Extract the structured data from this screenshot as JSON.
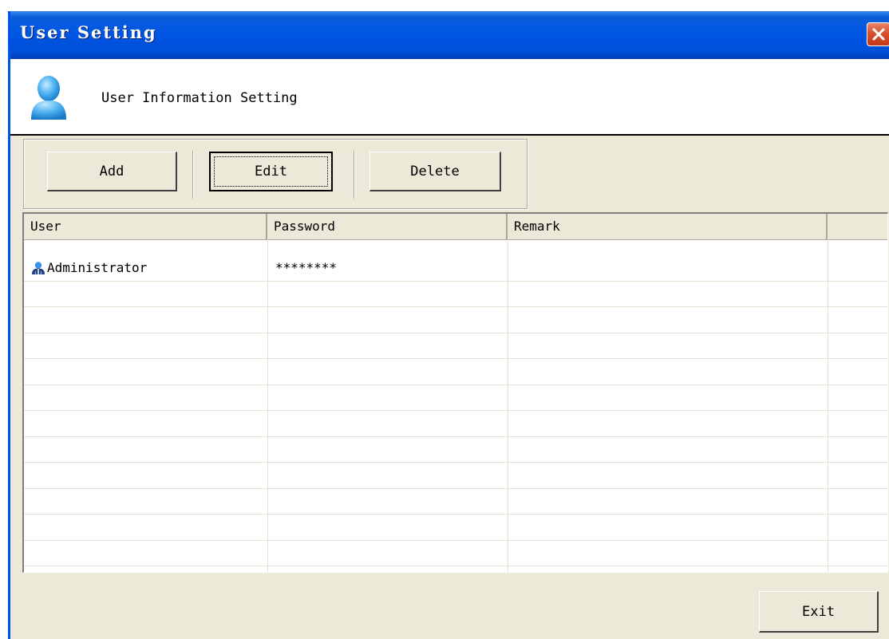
{
  "window": {
    "title": "User Setting"
  },
  "header": {
    "text": "User Information Setting",
    "icon": "user-icon"
  },
  "toolbar": {
    "add_label": "Add",
    "edit_label": "Edit",
    "delete_label": "Delete"
  },
  "table": {
    "columns": [
      "User",
      "Password",
      "Remark",
      ""
    ],
    "rows": [
      {
        "user": "Administrator",
        "password": "********",
        "remark": ""
      }
    ]
  },
  "footer": {
    "exit_label": "Exit"
  },
  "colors": {
    "titlebar": "#0055e5",
    "dialog": "#ece9d8",
    "close": "#d9502e"
  }
}
